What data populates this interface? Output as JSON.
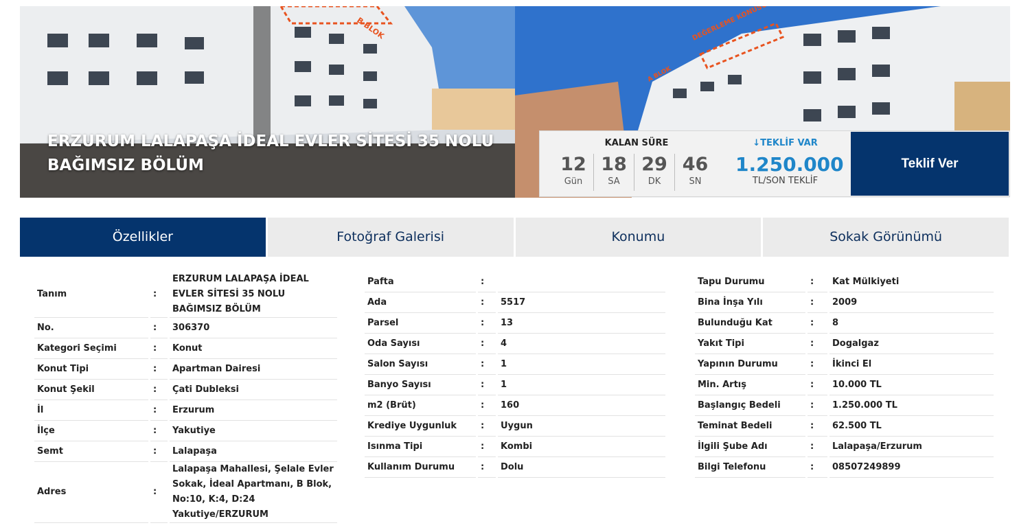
{
  "hero": {
    "title": "ERZURUM LALAPAŞA İDEAL EVLER SİTESİ 35 NOLU BAĞIMSIZ BÖLÜM",
    "left_photo_overlay": "B BLOK",
    "right_photo_overlay_1": "DEĞERLEME KONUSU TAŞINMAZ",
    "right_photo_overlay_2": "A BLOK"
  },
  "auction": {
    "remaining_label": "KALAN SÜRE",
    "timer": [
      {
        "value": "12",
        "unit": "Gün"
      },
      {
        "value": "18",
        "unit": "SA"
      },
      {
        "value": "29",
        "unit": "DK"
      },
      {
        "value": "46",
        "unit": "SN"
      }
    ],
    "offer_flag": "↓TEKLİF VAR",
    "offer_amount": "1.250.000",
    "offer_sub": "TL/SON TEKLİF",
    "bid_button": "Teklif Ver",
    "accent_color": "#1f86c9",
    "brand_color": "#05346d"
  },
  "tabs": [
    {
      "label": "Özellikler",
      "active": true
    },
    {
      "label": "Fotoğraf Galerisi",
      "active": false
    },
    {
      "label": "Konumu",
      "active": false
    },
    {
      "label": "Sokak Görünümü",
      "active": false
    }
  ],
  "properties": {
    "col1": [
      {
        "label": "Tanım",
        "sep": ":",
        "value": "ERZURUM LALAPAŞA İDEAL EVLER SİTESİ 35 NOLU BAĞIMSIZ BÖLÜM"
      },
      {
        "label": "No.",
        "sep": ":",
        "value": "306370"
      },
      {
        "label": "Kategori Seçimi",
        "sep": ":",
        "value": "Konut"
      },
      {
        "label": "Konut Tipi",
        "sep": ":",
        "value": "Apartman Dairesi"
      },
      {
        "label": "Konut Şekil",
        "sep": ":",
        "value": "Çati Dubleksi"
      },
      {
        "label": "İl",
        "sep": ":",
        "value": "Erzurum"
      },
      {
        "label": "İlçe",
        "sep": ":",
        "value": "Yakutiye"
      },
      {
        "label": "Semt",
        "sep": ":",
        "value": "Lalapaşa"
      },
      {
        "label": "Adres",
        "sep": ":",
        "value": "Lalapaşa Mahallesi, Şelale Evler Sokak, İdeal Apartmanı, B Blok, No:10, K:4, D:24 Yakutiye/ERZURUM"
      }
    ],
    "col2": [
      {
        "label": "Pafta",
        "sep": ":",
        "value": ""
      },
      {
        "label": "Ada",
        "sep": ":",
        "value": "5517"
      },
      {
        "label": "Parsel",
        "sep": ":",
        "value": "13"
      },
      {
        "label": "Oda Sayısı",
        "sep": ":",
        "value": "4"
      },
      {
        "label": "Salon Sayısı",
        "sep": ":",
        "value": "1"
      },
      {
        "label": "Banyo Sayısı",
        "sep": ":",
        "value": "1"
      },
      {
        "label": "m2 (Brüt)",
        "sep": ":",
        "value": "160"
      },
      {
        "label": "Krediye Uygunluk",
        "sep": ":",
        "value": "Uygun"
      },
      {
        "label": "Isınma Tipi",
        "sep": ":",
        "value": "Kombi"
      },
      {
        "label": "Kullanım Durumu",
        "sep": ":",
        "value": "Dolu"
      }
    ],
    "col3": [
      {
        "label": "Tapu Durumu",
        "sep": ":",
        "value": "Kat Mülkiyeti"
      },
      {
        "label": "Bina İnşa Yılı",
        "sep": ":",
        "value": "2009"
      },
      {
        "label": "Bulunduğu Kat",
        "sep": ":",
        "value": "8"
      },
      {
        "label": "Yakıt Tipi",
        "sep": ":",
        "value": "Dogalgaz"
      },
      {
        "label": "Yapının Durumu",
        "sep": ":",
        "value": "İkinci El"
      },
      {
        "label": "Min. Artış",
        "sep": ":",
        "value": "10.000 TL"
      },
      {
        "label": "Başlangıç Bedeli",
        "sep": ":",
        "value": "1.250.000 TL"
      },
      {
        "label": "Teminat Bedeli",
        "sep": ":",
        "value": "62.500 TL"
      },
      {
        "label": "İlgili Şube Adı",
        "sep": ":",
        "value": "Lalapaşa/Erzurum"
      },
      {
        "label": "Bilgi Telefonu",
        "sep": ":",
        "value": "08507249899"
      }
    ]
  }
}
